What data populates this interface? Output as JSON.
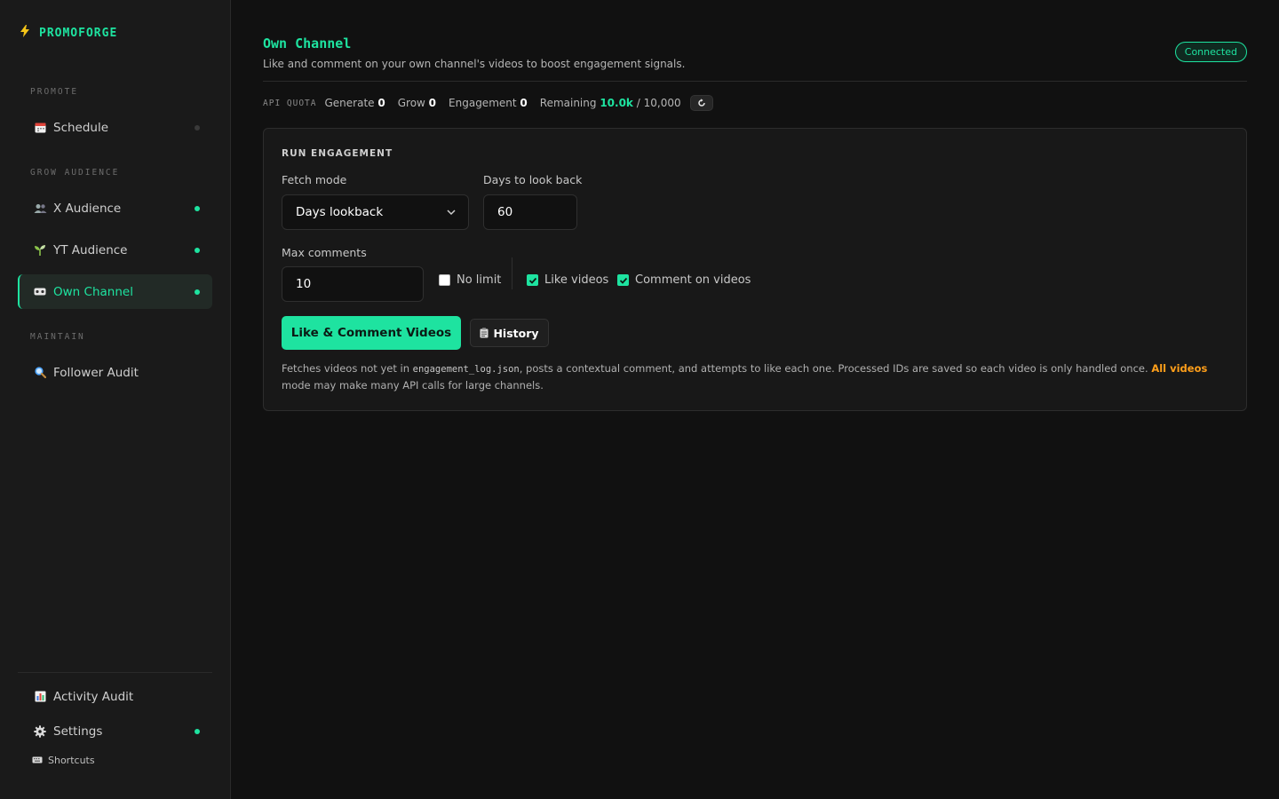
{
  "brand": {
    "icon": "lightning-icon",
    "name": "PROMOFORGE"
  },
  "sidebar": {
    "sections": {
      "promote": "PROMOTE",
      "grow": "GROW AUDIENCE",
      "maintain": "MAINTAIN"
    },
    "items": [
      {
        "id": "schedule",
        "icon": "calendar-icon",
        "label": "Schedule",
        "status": "inactive"
      },
      {
        "id": "x-audience",
        "icon": "people-icon",
        "label": "X Audience",
        "status": "active"
      },
      {
        "id": "yt-audience",
        "icon": "sprout-icon",
        "label": "YT Audience",
        "status": "active"
      },
      {
        "id": "own-channel",
        "icon": "video-camera-icon",
        "label": "Own Channel",
        "status": "active",
        "selected": true
      },
      {
        "id": "follower-audit",
        "icon": "magnifier-icon",
        "label": "Follower Audit"
      }
    ],
    "footer": [
      {
        "id": "activity-audit",
        "icon": "bar-chart-icon",
        "label": "Activity Audit"
      },
      {
        "id": "settings",
        "icon": "gear-icon",
        "label": "Settings",
        "status": "active"
      }
    ],
    "shortcuts": {
      "icon": "keyboard-icon",
      "label": "Shortcuts"
    }
  },
  "page": {
    "title": "Own Channel",
    "subtitle": "Like and comment on your own channel's videos to boost engagement signals.",
    "status": "Connected"
  },
  "quota": {
    "label": "API QUOTA",
    "generate_label": "Generate",
    "generate": "0",
    "grow_label": "Grow",
    "grow": "0",
    "engagement_label": "Engagement",
    "engagement": "0",
    "remaining_label": "Remaining",
    "remaining": "10.0k",
    "total": "/ 10,000",
    "refresh_icon": "refresh-icon"
  },
  "engagement": {
    "title": "RUN ENGAGEMENT",
    "fetch_mode_label": "Fetch mode",
    "fetch_mode_value": "Days lookback",
    "days_label": "Days to look back",
    "days_value": "60",
    "max_comments_label": "Max comments",
    "max_comments_value": "10",
    "no_limit_label": "No limit",
    "no_limit_checked": false,
    "like_label": "Like videos",
    "like_checked": true,
    "comment_label": "Comment on videos",
    "comment_checked": true,
    "run_button": "Like & Comment Videos",
    "history_button": "History",
    "history_icon": "clipboard-icon",
    "help_part1": "Fetches videos not yet in ",
    "help_code": "engagement_log.json",
    "help_part2": ", posts a contextual comment, and attempts to like each one. Processed IDs are saved so each video is only handled once. ",
    "help_warn": "All videos",
    "help_part3": " mode may make many API calls for large channels."
  },
  "colors": {
    "accent": "#1ee3a0",
    "warning": "#ff9f1a",
    "background": "#111111",
    "panel": "#1a1a1a"
  }
}
